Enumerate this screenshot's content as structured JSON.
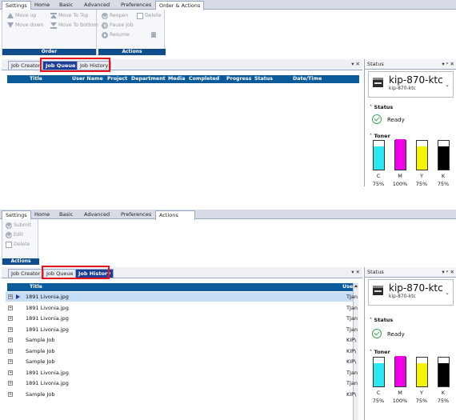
{
  "shot1": {
    "tabs": [
      "Settings",
      "Home",
      "Basic",
      "Advanced",
      "Preferences",
      "Order & Actions"
    ],
    "ribbon": {
      "order_group_label": "Order",
      "actions_group_label": "Actions",
      "move_up": "Move up",
      "move_down": "Move down",
      "move_to_top": "Move To Top",
      "move_to_bottom": "Move To Bottom",
      "reopen": "Reopen",
      "delete": "Delete",
      "pause_job": "Pause Job",
      "resume": "Resume"
    },
    "dock_tabs": [
      "Job Creator",
      "Job Queue",
      "Job History"
    ],
    "grid_columns": [
      "Title",
      "User Name",
      "Project",
      "Department",
      "Media",
      "Completed",
      "Progress",
      "Status",
      "Date/Time"
    ]
  },
  "shot2": {
    "tabs": [
      "Settings",
      "Home",
      "Basic",
      "Advanced",
      "Preferences",
      "Actions"
    ],
    "ribbon": {
      "submit": "Submit",
      "edit": "Edit",
      "delete": "Delete",
      "actions_group_label": "Actions"
    },
    "dock_tabs": [
      "Job Creator",
      "Job Queue",
      "Job History"
    ],
    "grid_columns": [
      "Title",
      "Use"
    ],
    "rows": [
      {
        "title": "1891 Livonia.jpg",
        "user": "TJan"
      },
      {
        "title": "1891 Livonia.jpg",
        "user": "TJan"
      },
      {
        "title": "1891 Livonia.jpg",
        "user": "TJan"
      },
      {
        "title": "1891 Livonia.jpg",
        "user": "TJan"
      },
      {
        "title": "Sample Job",
        "user": "KIP\\"
      },
      {
        "title": "Sample Job",
        "user": "KIP\\"
      },
      {
        "title": "Sample Job",
        "user": "KIP\\"
      },
      {
        "title": "1891 Livonia.jpg",
        "user": "TJan"
      },
      {
        "title": "1891 Livonia.jpg",
        "user": "TJan"
      },
      {
        "title": "Sample Job",
        "user": "KIP\\"
      }
    ]
  },
  "status_panel": {
    "title": "Status",
    "controls": "▾ ᵖ ✕",
    "printer_name": "kip-870-ktc",
    "printer_sub": "kip-870-ktc",
    "status_label": "Status",
    "status_value": "Ready",
    "toner_label": "Toner",
    "toners": [
      {
        "name": "C",
        "percent": "75%",
        "level": 0.75,
        "color": "#29e8ef"
      },
      {
        "name": "M",
        "percent": "100%",
        "level": 1.0,
        "color": "#f000e8"
      },
      {
        "name": "Y",
        "percent": "75%",
        "level": 0.75,
        "color": "#f4f400"
      },
      {
        "name": "K",
        "percent": "75%",
        "level": 0.75,
        "color": "#000000"
      }
    ]
  },
  "colors": {
    "accent_blue": "#1c3d96",
    "grid_header": "#0b5a9a",
    "highlight_red": "#e5151b",
    "selected_row": "#c6ddf6"
  }
}
